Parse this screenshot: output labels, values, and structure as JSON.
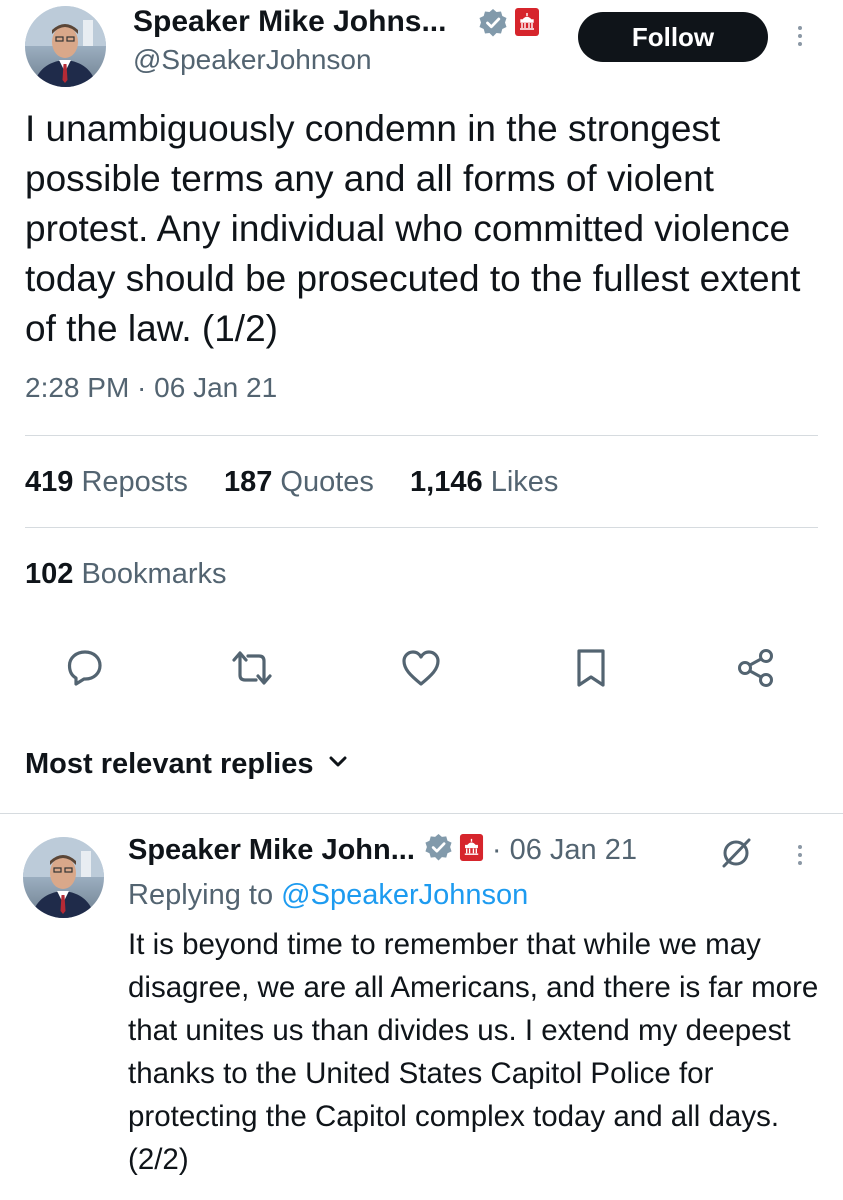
{
  "tweet": {
    "author_name": "Speaker Mike Johns...",
    "author_handle": "@SpeakerJohnson",
    "follow_label": "Follow",
    "text": "I unambiguously condemn in the strongest possible terms any and all forms of violent protest. Any individual who committed violence today should be prosecuted to the fullest extent of the law. (1/2)",
    "timestamp": "2:28 PM · 06 Jan 21",
    "reposts_count": "419",
    "reposts_label": "Reposts",
    "quotes_count": "187",
    "quotes_label": "Quotes",
    "likes_count": "1,146",
    "likes_label": "Likes",
    "bookmarks_count": "102",
    "bookmarks_label": "Bookmarks"
  },
  "actions": {
    "icons": [
      "reply-icon",
      "repost-icon",
      "like-icon",
      "bookmark-icon",
      "share-icon"
    ]
  },
  "replies": {
    "sort_label": "Most relevant replies",
    "items": [
      {
        "author_name": "Speaker Mike John...",
        "date": "· 06 Jan 21",
        "replying_prefix": "Replying to",
        "replying_handle": "@SpeakerJohnson",
        "text": "It is beyond time to remember that while we may disagree, we are all Americans, and there is far more that unites us than divides us. I extend my deepest thanks to the United States Capitol Police for protecting the Capitol complex today and all days. (2/2)"
      }
    ]
  },
  "colors": {
    "text": "#0f1419",
    "secondary": "#536471",
    "accent": "#1d9bf0",
    "verified_badge": "#829aab",
    "affiliation_badge": "#d6252c",
    "divider": "#d6dbdf"
  }
}
